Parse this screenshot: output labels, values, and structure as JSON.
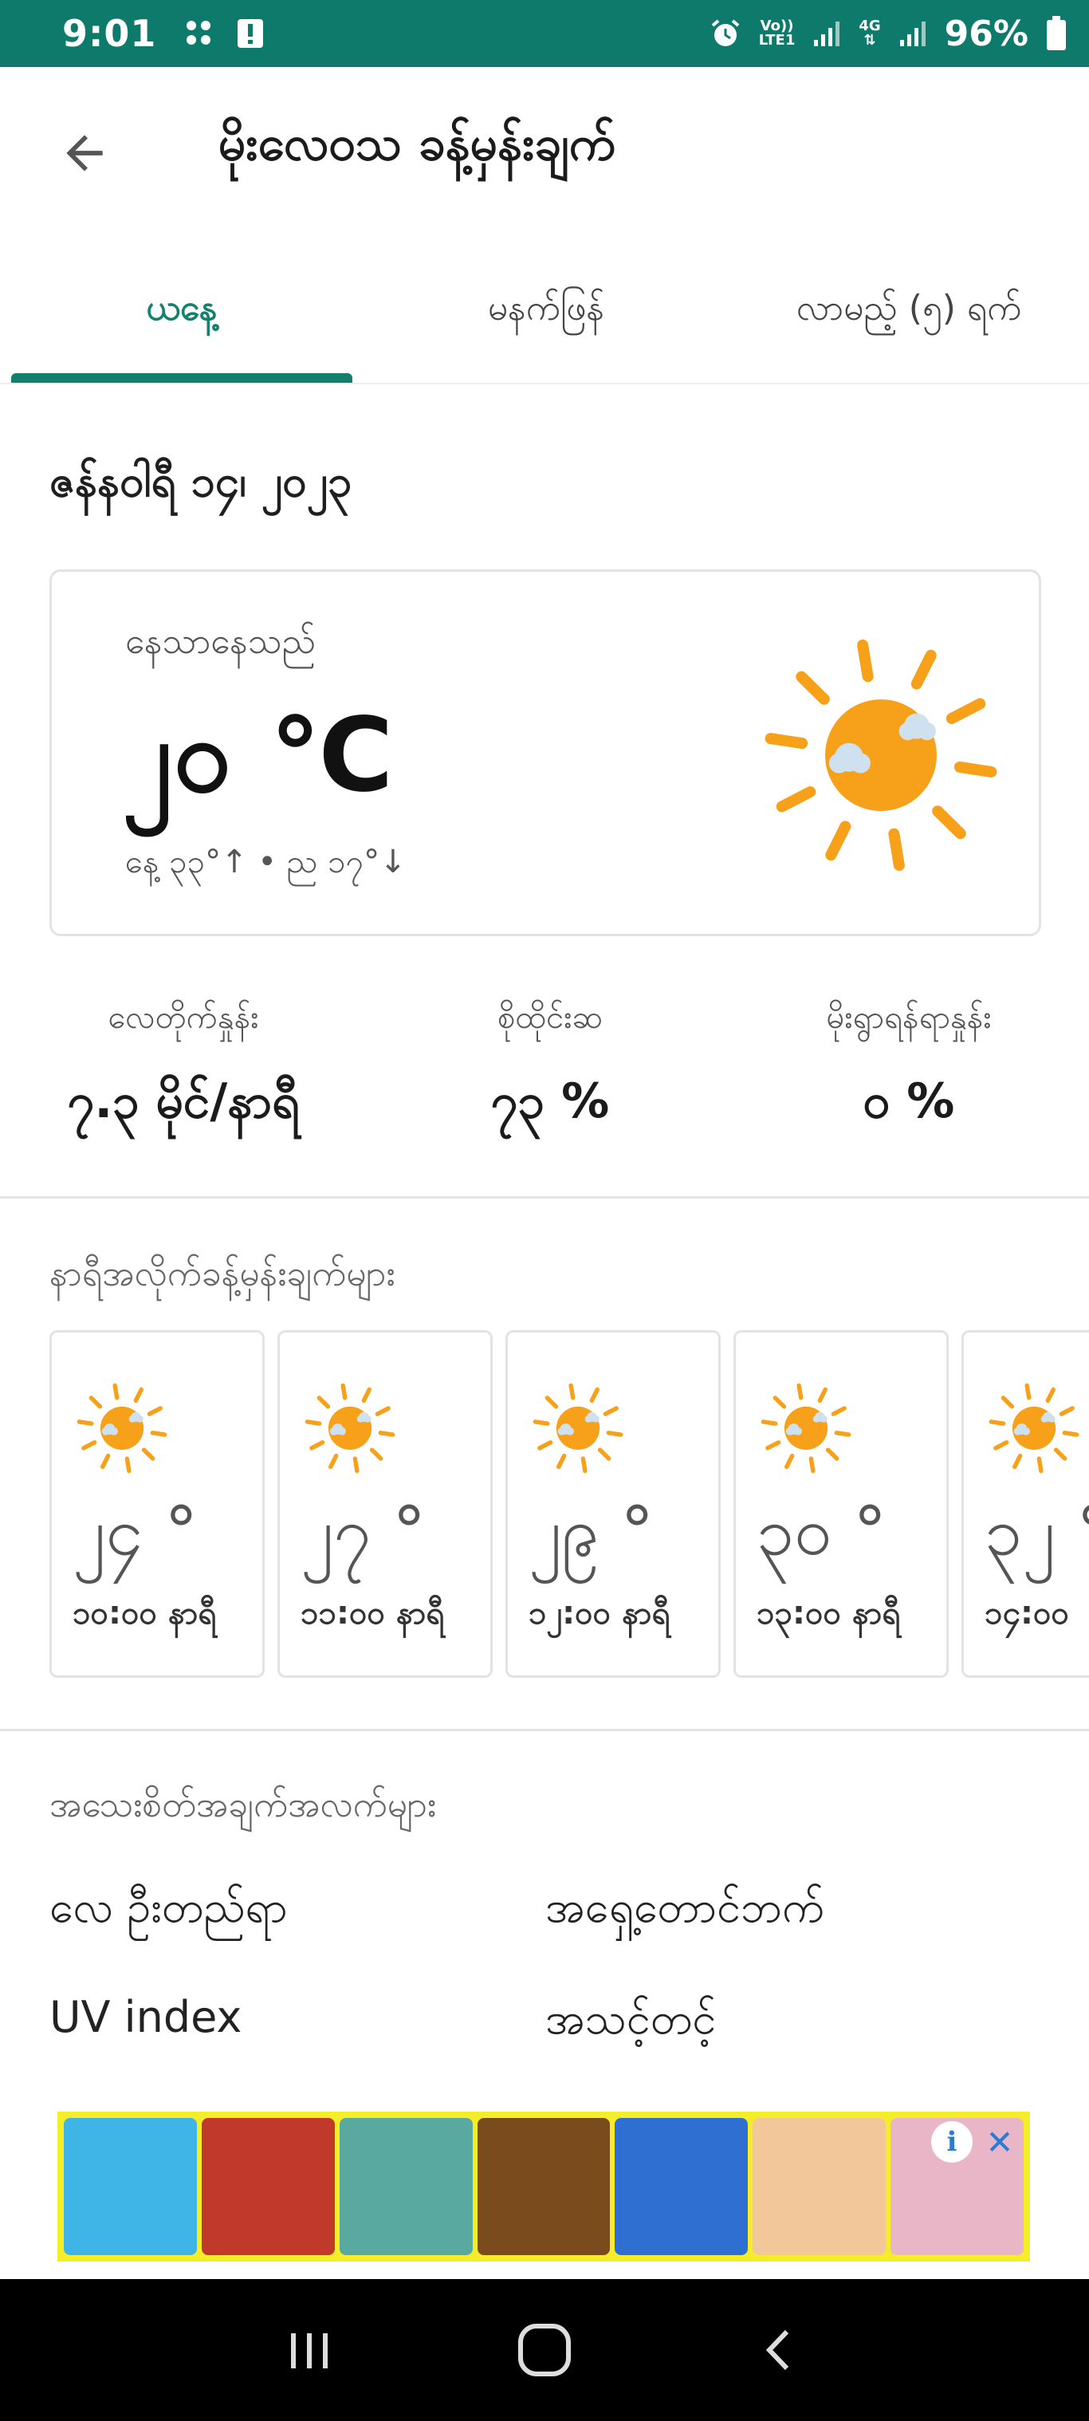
{
  "status_bar": {
    "time": "9:01",
    "battery": "96%",
    "network_line1": "Vo))",
    "network_line2": "LTE1",
    "data_type_4g": "4G",
    "icons": [
      "grid-notification-icon",
      "alert-notification-icon",
      "alarm-icon",
      "signal-icon",
      "signal-icon",
      "battery-icon"
    ]
  },
  "app_bar": {
    "back_icon": "arrow-back-icon",
    "title": "မိုးလေဝသ ခန့်မှန်းချက်"
  },
  "tabs": [
    {
      "label": "ယနေ့",
      "active": true
    },
    {
      "label": "မနက်ဖြန်",
      "active": false
    },
    {
      "label": "လာမည့် (၅) ရက်",
      "active": false
    }
  ],
  "date": "ဇန်နဝါရီ ၁၄၊ ၂၀၂၃",
  "current": {
    "label": "နေသာနေသည်",
    "temperature": "၂၀ ℃",
    "high_low": "နေ့ ၃၃°↑ • ည ၁၇°↓",
    "icon": "sunny-icon"
  },
  "stats": [
    {
      "label": "လေတိုက်နှုန်း",
      "value": "၇.၃ မိုင်/နာရီ"
    },
    {
      "label": "စိုထိုင်းဆ",
      "value": "၇၃ %"
    },
    {
      "label": "မိုးရွာရန်ရာနှုန်း",
      "value": "၀ %"
    }
  ],
  "hourly_title": "နာရီအလိုက်ခန့်မှန်းချက်များ",
  "hourly": [
    {
      "temp": "၂၄ °",
      "time": "၁၀:၀၀ နာရီ",
      "icon": "sunny-icon"
    },
    {
      "temp": "၂၇ °",
      "time": "၁၁:၀၀ နာရီ",
      "icon": "sunny-icon"
    },
    {
      "temp": "၂၉ °",
      "time": "၁၂:၀၀ နာရီ",
      "icon": "sunny-icon"
    },
    {
      "temp": "၃၀ °",
      "time": "၁၃:၀၀ နာရီ",
      "icon": "sunny-icon"
    },
    {
      "temp": "၃၂ °",
      "time": "၁၄:၀၀",
      "icon": "sunny-icon"
    }
  ],
  "details_title": "အသေးစိတ်အချက်အလက်များ",
  "details": [
    {
      "label": "လေ ဦးတည်ရာ",
      "value": "အရှေ့တောင်ဘက်"
    },
    {
      "label": "UV index",
      "value": "အသင့်တင့်"
    }
  ],
  "colors": {
    "status_bar": "#0e7a6b",
    "accent": "#13806d",
    "sun": "#f7a11a",
    "ad_border": "#f5ed2a"
  }
}
